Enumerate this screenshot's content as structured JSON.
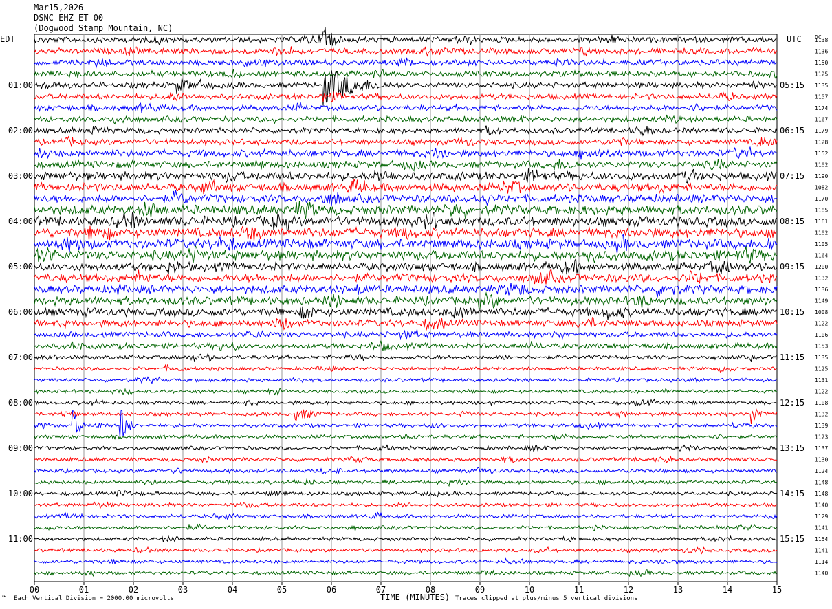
{
  "header": {
    "date": "Mar15,2026",
    "station": "DSNC EHZ ET 00",
    "location": "(Dogwood Stamp Mountain, NC)"
  },
  "footer": {
    "scale_note": "Each Vertical Division = 2000.00 microvolts",
    "clip_note": "Traces clipped at plus/minus 5 vertical divisions",
    "mark": "℠"
  },
  "chart_data": {
    "type": "line",
    "title": "",
    "xlabel": "TIME (MINUTES)",
    "x_ticks": [
      "00",
      "01",
      "02",
      "03",
      "04",
      "05",
      "06",
      "07",
      "08",
      "09",
      "10",
      "11",
      "12",
      "13",
      "14",
      "15"
    ],
    "xlim": [
      0,
      15
    ],
    "left_axis_label": "EDT",
    "right_axis_label": "UTC",
    "dc_label": "DC",
    "left_hour_labels": [
      "01:00",
      "02:00",
      "03:00",
      "04:00",
      "05:00",
      "06:00",
      "07:00",
      "08:00",
      "09:00",
      "10:00",
      "11:00"
    ],
    "right_hour_labels": [
      "05:15",
      "06:15",
      "07:15",
      "08:15",
      "09:15",
      "10:15",
      "11:15",
      "12:15",
      "13:15",
      "14:15",
      "15:15"
    ],
    "trace_colors": [
      "#000000",
      "#ff0000",
      "#0000ff",
      "#006400"
    ],
    "dc_offsets": [
      1138,
      1136,
      1150,
      1125,
      1135,
      1157,
      1174,
      1167,
      1179,
      1128,
      1152,
      1102,
      1190,
      1082,
      1170,
      1185,
      1161,
      1102,
      1105,
      1164,
      1200,
      1132,
      1136,
      1149,
      1008,
      1122,
      1106,
      1153,
      1135,
      1125,
      1131,
      1122,
      1108,
      1132,
      1139,
      1123,
      1137,
      1130,
      1124,
      1148,
      1148,
      1140,
      1129,
      1141,
      1154,
      1141,
      1114,
      1140
    ],
    "noise_level": [
      4,
      4,
      4,
      4,
      4,
      4,
      4,
      4,
      4,
      4,
      5,
      5,
      6,
      6,
      6,
      7,
      7,
      7,
      7,
      7,
      6,
      6,
      6,
      6,
      6,
      5,
      4,
      4,
      3,
      2.5,
      2.5,
      2.5,
      2.5,
      2.5,
      2.5,
      2.5,
      2.5,
      2.5,
      2.5,
      2.5,
      2.5,
      2.5,
      2.5,
      2.5,
      2.5,
      2.5,
      2.5,
      2.5
    ],
    "events": [
      {
        "row": 0,
        "minute": 5.85,
        "amplitude": 40,
        "duration": 0.3
      },
      {
        "row": 4,
        "minute": 5.85,
        "amplitude": 30,
        "duration": 1.5
      },
      {
        "row": 4,
        "minute": 2.9,
        "amplitude": 14,
        "duration": 0.6
      },
      {
        "row": 5,
        "minute": 5.85,
        "amplitude": 12,
        "duration": 0.8
      },
      {
        "row": 34,
        "minute": 0.8,
        "amplitude": 24,
        "duration": 0.25
      },
      {
        "row": 34,
        "minute": 1.25,
        "amplitude": 14,
        "duration": 0.2
      },
      {
        "row": 34,
        "minute": 1.75,
        "amplitude": 30,
        "duration": 0.3
      },
      {
        "row": 33,
        "minute": 14.5,
        "amplitude": 16,
        "duration": 0.4
      },
      {
        "row": 33,
        "minute": 5.3,
        "amplitude": 9,
        "duration": 1.2
      },
      {
        "row": 13,
        "minute": 6.5,
        "amplitude": 10,
        "duration": 0.6
      },
      {
        "row": 9,
        "minute": 14.6,
        "amplitude": 10,
        "duration": 0.5
      }
    ]
  }
}
